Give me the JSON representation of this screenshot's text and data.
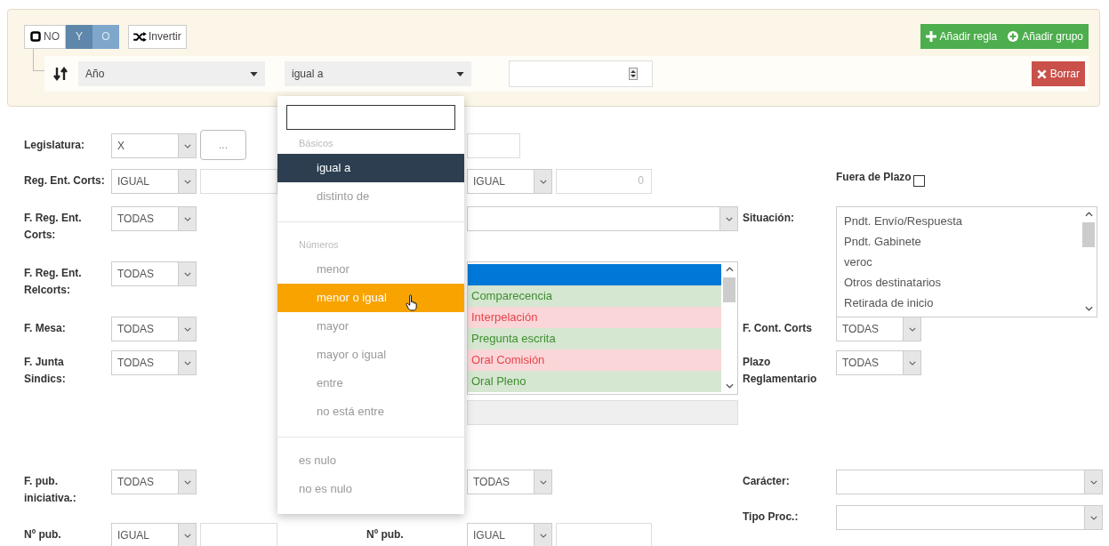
{
  "query_builder": {
    "not_toggle": {
      "label": "NO",
      "checked": false
    },
    "conditions": [
      {
        "label": "Y",
        "selected": true
      },
      {
        "label": "O",
        "selected": false
      }
    ],
    "invert_button": "Invertir",
    "add_rule_button": "Añadir regla",
    "add_group_button": "Añadir grupo",
    "rule": {
      "field": "Año",
      "operator": "igual a",
      "delete_button": "Borrar"
    },
    "operator_menu": {
      "groups": [
        {
          "header": "Básicos",
          "options": [
            {
              "label": "igual a",
              "selected": true,
              "hovered": false
            },
            {
              "label": "distinto de",
              "selected": false,
              "hovered": false
            }
          ]
        },
        {
          "header": "Números",
          "options": [
            {
              "label": "menor",
              "selected": false,
              "hovered": false
            },
            {
              "label": "menor o igual",
              "selected": false,
              "hovered": true
            },
            {
              "label": "mayor",
              "selected": false,
              "hovered": false
            },
            {
              "label": "mayor o igual",
              "selected": false,
              "hovered": false
            },
            {
              "label": "entre",
              "selected": false,
              "hovered": false
            },
            {
              "label": "no está entre",
              "selected": false,
              "hovered": false
            }
          ]
        },
        {
          "options": [
            {
              "label": "es nulo",
              "selected": false,
              "hovered": false
            },
            {
              "label": "no es nulo",
              "selected": false,
              "hovered": false
            }
          ]
        }
      ]
    }
  },
  "form": {
    "left": [
      {
        "kind": "select_button",
        "label": "Legislatura:",
        "value": "X",
        "button": "..."
      },
      {
        "kind": "select_input",
        "label": "Reg. Ent. Corts:",
        "value": "IGUAL"
      },
      {
        "kind": "select",
        "label": "F. Reg. Ent. Corts:",
        "value": "TODAS"
      },
      {
        "kind": "select",
        "label": "F. Reg. Ent. Relcorts:",
        "value": "TODAS"
      },
      {
        "kind": "select",
        "label": "F. Mesa:",
        "value": "TODAS"
      },
      {
        "kind": "select",
        "label": "F. Junta Sindics:",
        "value": "TODAS"
      },
      {
        "kind": "select",
        "label": "F. pub. iniciativa.:",
        "value": "TODAS"
      },
      {
        "kind": "select_input",
        "label": "Nº pub.",
        "value": "IGUAL"
      }
    ],
    "middle": {
      "reg_operator": "IGUAL",
      "reg_value": "0",
      "types": [
        {
          "selected": true
        },
        {
          "label": "Comparecencia",
          "color": "#3f8f2f",
          "selected": false
        },
        {
          "label": "Interpelación",
          "color": "#e8434c",
          "selected": false
        },
        {
          "label": "Pregunta escrita",
          "color": "#3f8f2f",
          "selected": false
        },
        {
          "label": "Oral Comisión",
          "color": "#e8434c",
          "selected": false
        },
        {
          "label": "Oral Pleno",
          "color": "#3f8f2f",
          "selected": false
        }
      ],
      "pub_value": "TODAS",
      "npub_label": "Nº pub.",
      "npub_operator": "IGUAL"
    },
    "right": {
      "out_of_term": {
        "label": "Fuera de Plazo",
        "checked": false
      },
      "situation": {
        "label": "Situación:",
        "options": [
          "Pndt. Envío/Respuesta",
          "Pndt. Gabinete",
          "veroc",
          "Otros destinatarios",
          "Retirada de inicio"
        ]
      },
      "cont_corts": {
        "label": "F. Cont. Corts",
        "value": "TODAS"
      },
      "term": {
        "label": "Plazo Reglamentario",
        "value": "TODAS"
      },
      "character": {
        "label": "Carácter:"
      },
      "proc_type": {
        "label": "Tipo Proc.:"
      }
    }
  }
}
